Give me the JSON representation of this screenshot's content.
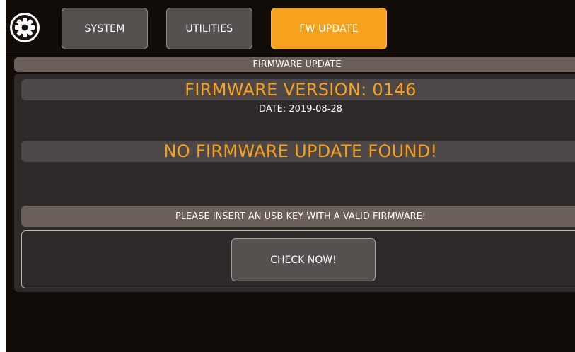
{
  "nav": {
    "settings_icon": "gear-icon",
    "tabs": [
      {
        "label": "SYSTEM",
        "active": false
      },
      {
        "label": "UTILITIES",
        "active": false
      },
      {
        "label": "FW UPDATE",
        "active": true
      }
    ]
  },
  "section": {
    "title": "FIRMWARE UPDATE"
  },
  "firmware": {
    "version_label": "FIRMWARE VERSION: 0146",
    "date_label": "DATE: 2019-08-28",
    "status": "NO FIRMWARE UPDATE FOUND!",
    "instruction": "PLEASE INSERT AN USB KEY WITH A VALID FIRMWARE!",
    "check_button": "CHECK NOW!"
  },
  "colors": {
    "accent": "#f7a21f",
    "background": "#110c08",
    "panel": "#2d2a29",
    "header_bar": "#6b5f59"
  }
}
